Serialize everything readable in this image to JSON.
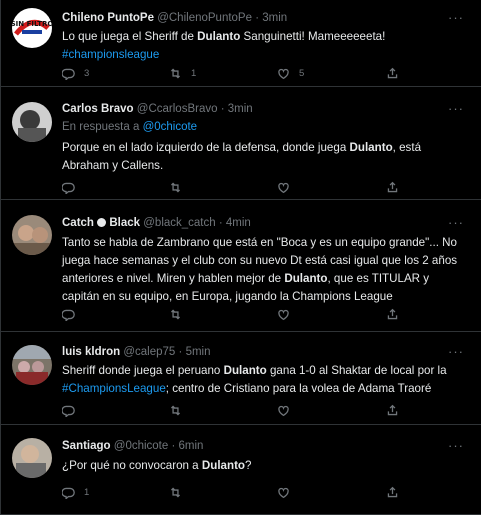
{
  "tweets": [
    {
      "name": "Chileno PuntoPe",
      "handle": "@ChilenoPuntoPe",
      "time": "3min",
      "reply_to": "",
      "text_parts": [
        {
          "t": "Lo que juega el Sheriff de ",
          "s": "n"
        },
        {
          "t": "Dulanto",
          "s": "b"
        },
        {
          "t": " Sanguinetti! Mameeeeeeta! ",
          "s": "n"
        },
        {
          "t": "#championsleague",
          "s": "l"
        }
      ],
      "replies": "3",
      "retweets": "1",
      "likes": "5"
    },
    {
      "name": "Carlos Bravo",
      "handle": "@CcarlosBravo",
      "time": "3min",
      "reply_to_label": "En respuesta a",
      "reply_to": "@0chicote",
      "text_parts": [
        {
          "t": "Porque en el lado izquierdo de la defensa, donde juega ",
          "s": "n"
        },
        {
          "t": "Dulanto",
          "s": "b"
        },
        {
          "t": ", está Abraham y Callens.",
          "s": "n"
        }
      ],
      "replies": "",
      "retweets": "",
      "likes": ""
    },
    {
      "name": "Catch",
      "name_extra": "Black",
      "handle": "@black_catch",
      "time": "4min",
      "reply_to": "",
      "text_parts": [
        {
          "t": "Tanto se habla de Zambrano que está en \"Boca y es un equipo grande\"... No juega hace semanas y el club con su nuevo Dt está casi igual que los 2 años anteriores e nivel. Miren y hablen mejor de ",
          "s": "n"
        },
        {
          "t": "Dulanto",
          "s": "b"
        },
        {
          "t": ", que es TITULAR y capitán en su equipo, en Europa, jugando la Champions League",
          "s": "n"
        }
      ],
      "replies": "",
      "retweets": "",
      "likes": ""
    },
    {
      "name": "luis kldron",
      "handle": "@calep75",
      "time": "5min",
      "reply_to": "",
      "text_parts": [
        {
          "t": "Sheriff donde juega el peruano ",
          "s": "n"
        },
        {
          "t": "Dulanto",
          "s": "b"
        },
        {
          "t": " gana 1-0 al Shaktar de local por la ",
          "s": "n"
        },
        {
          "t": "#ChampionsLeague",
          "s": "l"
        },
        {
          "t": "; centro de Cristiano para la volea de Adama Traoré",
          "s": "n"
        }
      ],
      "replies": "",
      "retweets": "",
      "likes": ""
    },
    {
      "name": "Santiago",
      "handle": "@0chicote",
      "time": "6min",
      "reply_to": "",
      "text_parts": [
        {
          "t": "¿Por qué no convocaron a ",
          "s": "n"
        },
        {
          "t": "Dulanto",
          "s": "b"
        },
        {
          "t": "?",
          "s": "n"
        }
      ],
      "replies": "1",
      "retweets": "",
      "likes": ""
    }
  ],
  "icons": {
    "reply": "reply-icon",
    "retweet": "retweet-icon",
    "like": "heart-icon",
    "share": "share-icon",
    "more": "more-options-icon"
  },
  "avatar_logo_text": "SIN FILTRO",
  "colors": {
    "accent": "#1d9bf0",
    "muted": "#71767b",
    "text": "#e7e9ea",
    "bg": "#000000"
  }
}
